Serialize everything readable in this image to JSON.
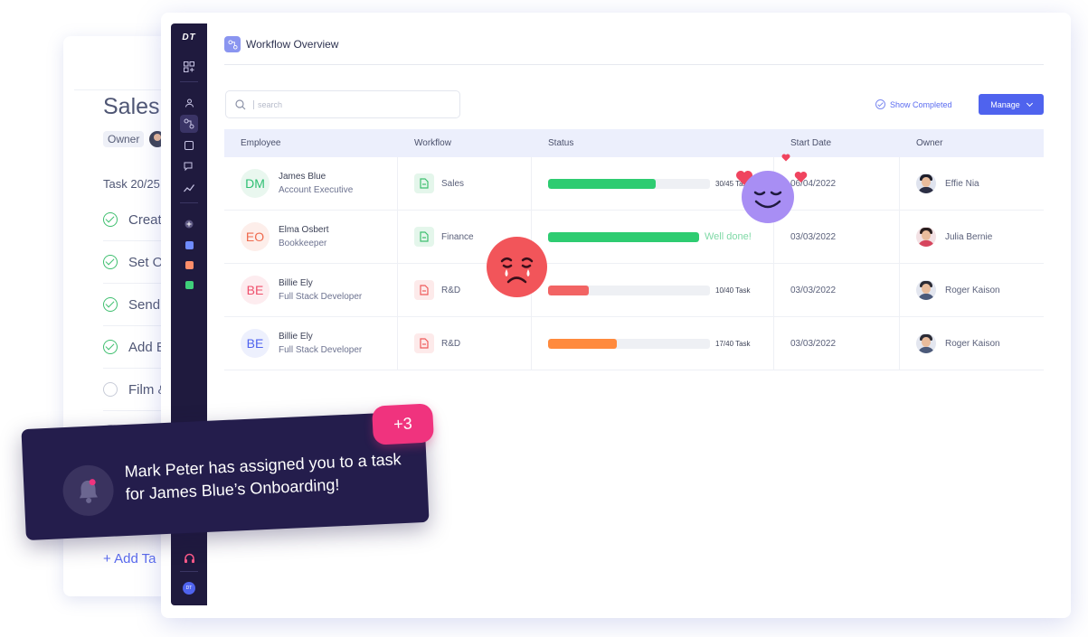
{
  "back_card": {
    "title": "Sales",
    "owner_label": "Owner",
    "task_count": "Task 20/25",
    "tasks": [
      {
        "label": "Creat",
        "done": true
      },
      {
        "label": "Set O",
        "done": true
      },
      {
        "label": "Send",
        "done": true
      },
      {
        "label": "Add E",
        "done": true
      },
      {
        "label": "Film &",
        "done": false
      },
      {
        "label": "",
        "done": false
      }
    ],
    "add_task": "+ Add Ta"
  },
  "sidebar": {
    "logo": "DT",
    "user_initials": "DT"
  },
  "header": {
    "title": "Workflow Overview"
  },
  "search": {
    "placeholder": "search"
  },
  "toolbar": {
    "show_completed": "Show Completed",
    "manage": "Manage"
  },
  "table": {
    "columns": [
      "Employee",
      "Workflow",
      "Status",
      "Start Date",
      "Owner"
    ],
    "rows": [
      {
        "initials": "DM",
        "initials_color": "#2fbf73",
        "initials_bg": "#e9f7ef",
        "name": "James Blue",
        "role": "Account Executive",
        "workflow": "Sales",
        "wf_color": "#3fbf6f",
        "wf_bg": "#e4f6eb",
        "progress": 30,
        "total": 45,
        "status_text": "30/45 Task",
        "bar_color": "#2ecc71",
        "done": false,
        "start_date": "06/04/2022",
        "owner": "Effie Nia",
        "owner_style": "dark"
      },
      {
        "initials": "EO",
        "initials_color": "#ef6b4f",
        "initials_bg": "#fdeeea",
        "name": "Elma Osbert",
        "role": "Bookkeeper",
        "workflow": "Finance",
        "wf_color": "#3fbf6f",
        "wf_bg": "#e4f6eb",
        "progress": 1,
        "total": 1,
        "status_text": "Well done!",
        "bar_color": "#2ecc71",
        "done": true,
        "start_date": "03/03/2022",
        "owner": "Julia Bernie",
        "owner_style": "female"
      },
      {
        "initials": "BE",
        "initials_color": "#ef4f6b",
        "initials_bg": "#fdecef",
        "name": "Billie Ely",
        "role": "Full Stack Developer",
        "workflow": "R&D",
        "wf_color": "#ef5a5a",
        "wf_bg": "#fdeaea",
        "progress": 10,
        "total": 40,
        "status_text": "10/40 Task",
        "bar_color": "#f26464",
        "done": false,
        "start_date": "03/03/2022",
        "owner": "Roger Kaison",
        "owner_style": "male"
      },
      {
        "initials": "BE",
        "initials_color": "#4f63ee",
        "initials_bg": "#edf0fd",
        "name": "Billie Ely",
        "role": "Full Stack Developer",
        "workflow": "R&D",
        "wf_color": "#ef5a5a",
        "wf_bg": "#fdeaea",
        "progress": 17,
        "total": 40,
        "status_text": "17/40 Task",
        "bar_color": "#ff8a3d",
        "done": false,
        "start_date": "03/03/2022",
        "owner": "Roger Kaison",
        "owner_style": "male"
      }
    ]
  },
  "notification": {
    "message": "Mark Peter has assigned you to a task for James Blue’s Onboarding!",
    "badge": "+3"
  },
  "colors": {
    "accent": "#4f63ee",
    "sidebar": "#1f1a3e",
    "notification_bg": "#241d4c",
    "badge": "#f0337e"
  }
}
